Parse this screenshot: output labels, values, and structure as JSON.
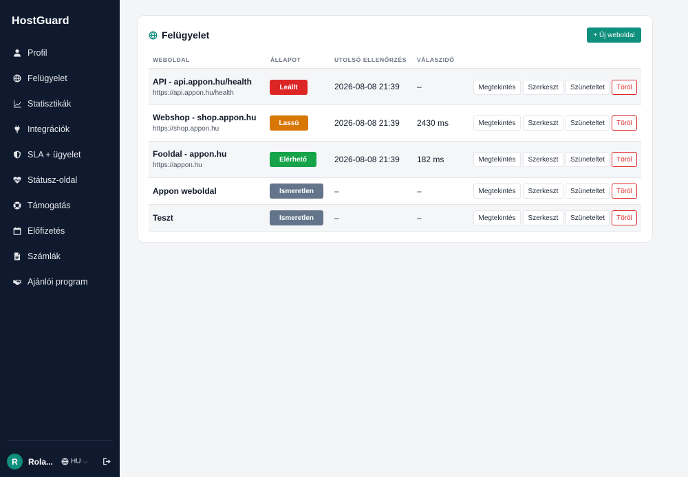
{
  "sidebar": {
    "brand": "HostGuard",
    "items": [
      {
        "label": "Profil",
        "icon": "user-icon"
      },
      {
        "label": "Felügyelet",
        "icon": "globe-icon"
      },
      {
        "label": "Statisztikák",
        "icon": "chart-line-icon"
      },
      {
        "label": "Integrációk",
        "icon": "plug-icon"
      },
      {
        "label": "SLA + ügyelet",
        "icon": "shield-icon"
      },
      {
        "label": "Státusz-oldal",
        "icon": "heartbeat-icon"
      },
      {
        "label": "Támogatás",
        "icon": "lifebuoy-icon"
      },
      {
        "label": "Előfizetés",
        "icon": "calendar-icon"
      },
      {
        "label": "Számlák",
        "icon": "document-icon"
      },
      {
        "label": "Ajánlói program",
        "icon": "handshake-icon"
      }
    ],
    "footer": {
      "avatar_initial": "R",
      "user_name": "Rola...",
      "language": "HU"
    }
  },
  "monitor": {
    "title": "Felügyelet",
    "add_button": "+ Új weboldal",
    "columns": [
      "WEBOLDAL",
      "ÁLLAPOT",
      "UTOLSÓ ELLENŐRZÉS",
      "VÁLASZIDŐ"
    ],
    "actions": {
      "view": "Megtekintés",
      "edit": "Szerkeszt",
      "pause": "Szüneteltet",
      "delete": "Töröl"
    },
    "rows": [
      {
        "name": "API - api.appon.hu/health",
        "url": "https://api.appon.hu/health",
        "status": "Leállt",
        "status_color": "#dc2626",
        "last_check": "2026-08-08 21:39",
        "response": "–"
      },
      {
        "name": "Webshop - shop.appon.hu",
        "url": "https://shop.appon.hu",
        "status": "Lassú",
        "status_color": "#d97706",
        "last_check": "2026-08-08 21:39",
        "response": "2430 ms"
      },
      {
        "name": "Fooldal - appon.hu",
        "url": "https://appon.hu",
        "status": "Elérhető",
        "status_color": "#16a34a",
        "last_check": "2026-08-08 21:39",
        "response": "182 ms"
      },
      {
        "name": "Appon weboldal",
        "url": "",
        "status": "Ismeretlen",
        "status_color": "#64748b",
        "last_check": "–",
        "response": "–"
      },
      {
        "name": "Teszt",
        "url": "",
        "status": "Ismeretlen",
        "status_color": "#64748b",
        "last_check": "–",
        "response": "–"
      }
    ]
  },
  "colors": {
    "accent": "#0f8f7e",
    "sidebar_bg": "#0f1a2e"
  }
}
